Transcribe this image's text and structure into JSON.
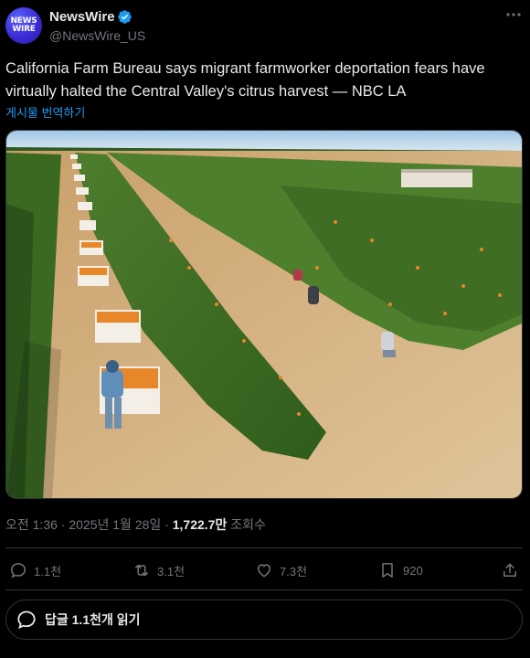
{
  "author": {
    "display_name": "NewsWire",
    "handle": "@NewsWire_US",
    "avatar_text_line1": "NEWS",
    "avatar_text_line2": "WIRE",
    "verified": true
  },
  "tweet": {
    "text": "California Farm Bureau says migrant farmworker deportation fears have virtually halted the Central Valley's citrus harvest — NBC LA",
    "translate_label": "게시물 번역하기"
  },
  "meta": {
    "time": "오전 1:36",
    "date": "2025년 1월 28일",
    "views_count": "1,722.7만",
    "views_label": "조회수"
  },
  "actions": {
    "replies": "1.1천",
    "retweets": "3.1천",
    "likes": "7.3천",
    "bookmarks": "920"
  },
  "read_replies": {
    "label": "답글 1.1천개 읽기"
  },
  "colors": {
    "background": "#000000",
    "text_primary": "#e7e9ea",
    "text_secondary": "#71767b",
    "accent": "#1d9bf0",
    "border": "#2f3336"
  },
  "icons": [
    "verified-badge-icon",
    "more-icon",
    "reply-icon",
    "retweet-icon",
    "like-icon",
    "bookmark-icon",
    "share-icon",
    "speech-bubble-icon"
  ]
}
